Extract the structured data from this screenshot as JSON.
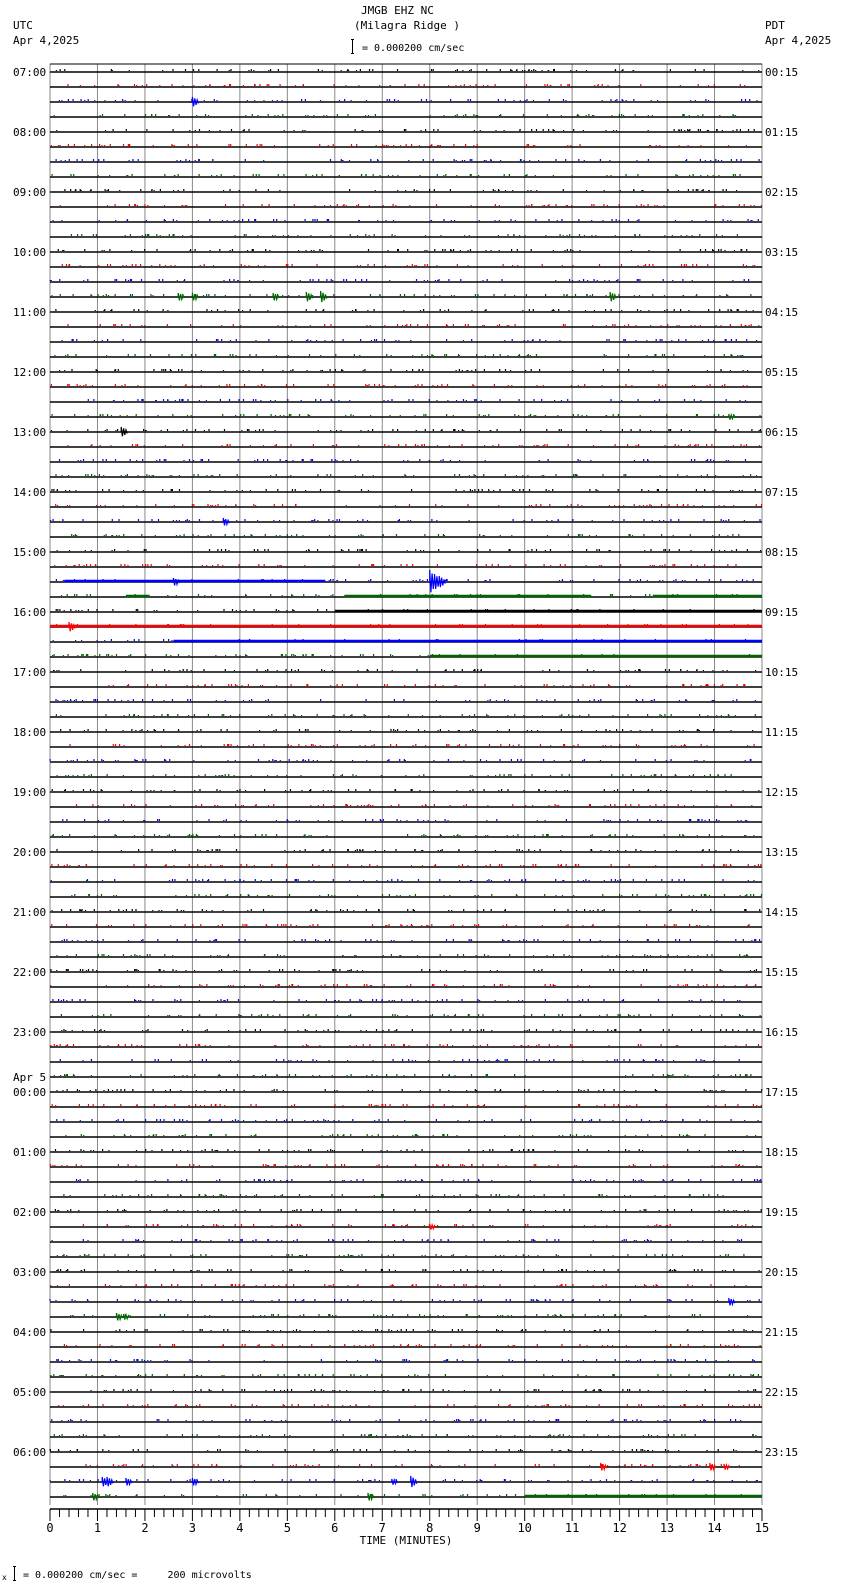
{
  "header": {
    "station": "JMGB EHZ NC",
    "location": "(Milagra Ridge )",
    "left_tz": "UTC",
    "left_date": "Apr 4,2025",
    "right_tz": "PDT",
    "right_date": "Apr 4,2025",
    "scale_text": "= 0.000200 cm/sec"
  },
  "footer": {
    "scale_text": "= 0.000200 cm/sec =     200 microvolts",
    "mark": "x"
  },
  "chart_data": {
    "type": "line",
    "title": "JMGB EHZ NC (Milagra Ridge )",
    "xlabel": "TIME (MINUTES)",
    "xlim": [
      0,
      15
    ],
    "x_ticks": [
      "0",
      "1",
      "2",
      "3",
      "4",
      "5",
      "6",
      "7",
      "8",
      "9",
      "10",
      "11",
      "12",
      "13",
      "14",
      "15"
    ],
    "trace_minutes": 15,
    "trace_count": 96,
    "trace_colors": [
      "#000000",
      "#ff0000",
      "#0000ff",
      "#006400"
    ],
    "day_change_label": "Apr 5",
    "day_change_trace": 68,
    "left_labels": [
      "07:00",
      "08:00",
      "09:00",
      "10:00",
      "11:00",
      "12:00",
      "13:00",
      "14:00",
      "15:00",
      "16:00",
      "17:00",
      "18:00",
      "19:00",
      "20:00",
      "21:00",
      "22:00",
      "23:00",
      "00:00",
      "01:00",
      "02:00",
      "03:00",
      "04:00",
      "05:00",
      "06:00"
    ],
    "right_labels": [
      "00:15",
      "01:15",
      "02:15",
      "03:15",
      "04:15",
      "05:15",
      "06:15",
      "07:15",
      "08:15",
      "09:15",
      "10:15",
      "11:15",
      "12:15",
      "13:15",
      "14:15",
      "15:15",
      "16:15",
      "17:15",
      "18:15",
      "19:15",
      "20:15",
      "21:15",
      "22:15",
      "23:15"
    ],
    "dense_segments": [
      {
        "trace": 34,
        "from": 0.3,
        "to": 5.8
      },
      {
        "trace": 35,
        "from": 1.6,
        "to": 2.1
      },
      {
        "trace": 35,
        "from": 6.2,
        "to": 11.4
      },
      {
        "trace": 35,
        "from": 12.7,
        "to": 15
      },
      {
        "trace": 36,
        "from": 6.0,
        "to": 15
      },
      {
        "trace": 37,
        "from": 0,
        "to": 15
      },
      {
        "trace": 38,
        "from": 2.6,
        "to": 15
      },
      {
        "trace": 39,
        "from": 8.0,
        "to": 15
      },
      {
        "trace": 95,
        "from": 10.0,
        "to": 15
      }
    ],
    "events": [
      {
        "trace": 2,
        "minute": 3.0,
        "amplitude": 5
      },
      {
        "trace": 15,
        "minute": 2.7,
        "amplitude": 4
      },
      {
        "trace": 15,
        "minute": 3.0,
        "amplitude": 4
      },
      {
        "trace": 15,
        "minute": 4.7,
        "amplitude": 4
      },
      {
        "trace": 15,
        "minute": 5.4,
        "amplitude": 5
      },
      {
        "trace": 15,
        "minute": 5.7,
        "amplitude": 6
      },
      {
        "trace": 15,
        "minute": 11.8,
        "amplitude": 5
      },
      {
        "trace": 23,
        "minute": 14.3,
        "amplitude": 3
      },
      {
        "trace": 24,
        "minute": 1.5,
        "amplitude": 5
      },
      {
        "trace": 30,
        "minute": 3.65,
        "amplitude": 4
      },
      {
        "trace": 34,
        "minute": 2.6,
        "amplitude": 4
      },
      {
        "trace": 34,
        "minute": 8.0,
        "amplitude": 12
      },
      {
        "trace": 34,
        "minute": 8.1,
        "amplitude": 8
      },
      {
        "trace": 34,
        "minute": 8.2,
        "amplitude": 6
      },
      {
        "trace": 37,
        "minute": 0.4,
        "amplitude": 5
      },
      {
        "trace": 77,
        "minute": 8.0,
        "amplitude": 3
      },
      {
        "trace": 82,
        "minute": 14.3,
        "amplitude": 4
      },
      {
        "trace": 83,
        "minute": 1.4,
        "amplitude": 4
      },
      {
        "trace": 83,
        "minute": 1.55,
        "amplitude": 3
      },
      {
        "trace": 93,
        "minute": 11.6,
        "amplitude": 4
      },
      {
        "trace": 93,
        "minute": 13.9,
        "amplitude": 4
      },
      {
        "trace": 93,
        "minute": 14.2,
        "amplitude": 3
      },
      {
        "trace": 94,
        "minute": 1.1,
        "amplitude": 5
      },
      {
        "trace": 94,
        "minute": 1.2,
        "amplitude": 5
      },
      {
        "trace": 94,
        "minute": 1.6,
        "amplitude": 4
      },
      {
        "trace": 94,
        "minute": 3.0,
        "amplitude": 4
      },
      {
        "trace": 94,
        "minute": 7.2,
        "amplitude": 3
      },
      {
        "trace": 94,
        "minute": 7.6,
        "amplitude": 6
      },
      {
        "trace": 95,
        "minute": 0.9,
        "amplitude": 4
      },
      {
        "trace": 95,
        "minute": 6.7,
        "amplitude": 4
      }
    ]
  }
}
